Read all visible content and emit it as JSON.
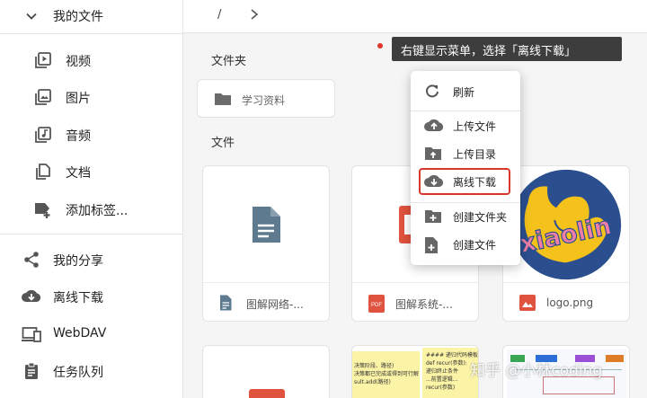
{
  "sidebar": {
    "my_files": "我的文件",
    "items": [
      {
        "label": "视频",
        "icon": "video-icon"
      },
      {
        "label": "图片",
        "icon": "image-icon"
      },
      {
        "label": "音频",
        "icon": "audio-icon"
      },
      {
        "label": "文档",
        "icon": "document-icon"
      },
      {
        "label": "添加标签...",
        "icon": "add-tag-icon"
      }
    ],
    "nav": [
      {
        "label": "我的分享",
        "icon": "share-icon"
      },
      {
        "label": "离线下载",
        "icon": "cloud-download-icon"
      },
      {
        "label": "WebDAV",
        "icon": "devices-icon"
      },
      {
        "label": "任务队列",
        "icon": "task-queue-icon"
      }
    ]
  },
  "breadcrumb": {
    "root": "/"
  },
  "sections": {
    "folders": "文件夹",
    "files": "文件"
  },
  "folders": [
    {
      "name": "学习资料"
    }
  ],
  "files": [
    {
      "name": "图解网络-...",
      "type": "document"
    },
    {
      "name": "图解系统-...",
      "type": "pdf"
    },
    {
      "name": "logo.png",
      "type": "image",
      "logo_text": "xiaolin"
    }
  ],
  "context_menu": {
    "items": [
      {
        "label": "刷新",
        "icon": "refresh-icon"
      },
      {
        "label": "上传文件",
        "icon": "cloud-upload-icon"
      },
      {
        "label": "上传目录",
        "icon": "upload-folder-icon"
      },
      {
        "label": "离线下载",
        "icon": "cloud-download-icon",
        "highlighted": true
      },
      {
        "label": "创建文件夹",
        "icon": "new-folder-icon"
      },
      {
        "label": "创建文件",
        "icon": "new-file-icon"
      }
    ]
  },
  "annotation": {
    "text": "右键显示菜单，选择「离线下载」"
  },
  "partial_cards": {
    "code_lines": [
      "#### 递归代码模板",
      "def recur(参数):",
      "  递归终止条件",
      "  ...前置逻辑...",
      "  recur(参数)"
    ],
    "side_lines": [
      "决策阶段、路径)",
      "决策都已完成或得到可行解",
      "sult.add(路径)"
    ]
  },
  "watermark": "知乎 @小林coding",
  "colors": {
    "accent": "#d9372b",
    "icon_grey": "#616161",
    "doc_blue": "#5e7a8f",
    "pdf_red": "#e0533e",
    "logo_blue": "#2b4f8e",
    "logo_yellow": "#f4c21a",
    "logo_pink": "#f07fa8"
  }
}
